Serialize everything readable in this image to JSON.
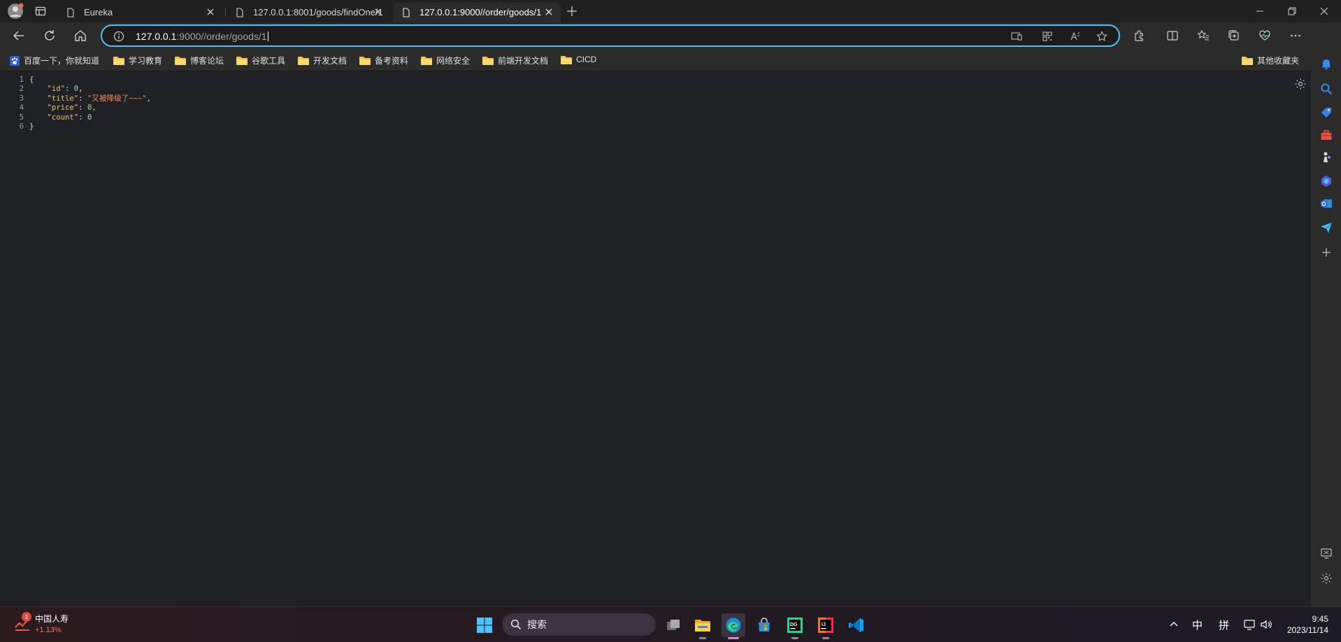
{
  "browser": {
    "tabs": [
      {
        "title": "Eureka",
        "active": false
      },
      {
        "title": "127.0.0.1:8001/goods/findOne/1",
        "active": false
      },
      {
        "title": "127.0.0.1:9000//order/goods/1",
        "active": true
      }
    ],
    "address": {
      "host": "127.0.0.1",
      "rest": ":9000//order/goods/1"
    },
    "bookmarks": [
      {
        "label": "百度一下，你就知道",
        "icon": "baidu-icon"
      },
      {
        "label": "学习教育",
        "icon": "folder-icon"
      },
      {
        "label": "博客论坛",
        "icon": "folder-icon"
      },
      {
        "label": "谷歌工具",
        "icon": "folder-icon"
      },
      {
        "label": "开发文档",
        "icon": "folder-icon"
      },
      {
        "label": "备考资料",
        "icon": "folder-icon"
      },
      {
        "label": "网络安全",
        "icon": "folder-icon"
      },
      {
        "label": "前端开发文档",
        "icon": "folder-icon"
      },
      {
        "label": "CICD",
        "icon": "folder-icon"
      }
    ],
    "other_bookmarks": "其他收藏夹"
  },
  "json_view": {
    "line_numbers": [
      "1",
      "2",
      "3",
      "4",
      "5",
      "6"
    ],
    "open_brace": "{",
    "close_brace": "}",
    "fields": [
      {
        "key": "\"id\"",
        "value": "0",
        "type": "number",
        "comma": ","
      },
      {
        "key": "\"title\"",
        "value": "\"又被降级了~~~\"",
        "type": "string",
        "comma": ","
      },
      {
        "key": "\"price\"",
        "value": "0",
        "type": "number",
        "comma": ","
      },
      {
        "key": "\"count\"",
        "value": "0",
        "type": "number",
        "comma": ""
      }
    ]
  },
  "taskbar": {
    "stock": {
      "name": "中国人寿",
      "change": "+1.13%",
      "badge": "1"
    },
    "search_label": "搜索",
    "tray": {
      "ime_lang": "中",
      "ime_mode": "拼"
    },
    "clock": {
      "time": "9:45",
      "date": "2023/11/14"
    }
  },
  "colors": {
    "accent": "#4cc2ff",
    "json_key": "#e3c07b",
    "json_string": "#ee8a5e",
    "json_number": "#a5d6a7"
  }
}
